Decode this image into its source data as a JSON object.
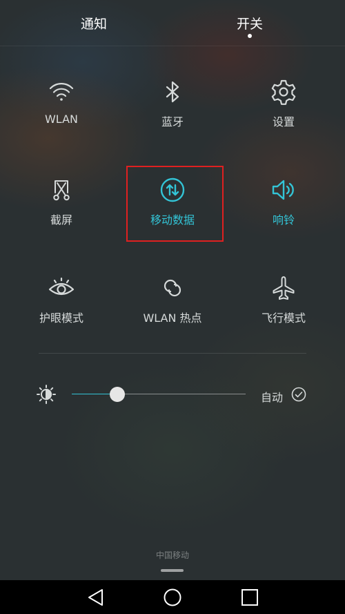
{
  "tabs": {
    "notifications": "通知",
    "switches": "开关",
    "active": "switches"
  },
  "toggles": [
    {
      "label": "WLAN",
      "icon": "wifi-icon",
      "active": false
    },
    {
      "label": "蓝牙",
      "icon": "bluetooth-icon",
      "active": false
    },
    {
      "label": "设置",
      "icon": "gear-icon",
      "active": false
    },
    {
      "label": "截屏",
      "icon": "screenshot-icon",
      "active": false
    },
    {
      "label": "移动数据",
      "icon": "mobile-data-icon",
      "active": true
    },
    {
      "label": "响铃",
      "icon": "speaker-icon",
      "active": true
    },
    {
      "label": "护眼模式",
      "icon": "eye-icon",
      "active": false
    },
    {
      "label": "WLAN 热点",
      "icon": "hotspot-icon",
      "active": false
    },
    {
      "label": "飞行模式",
      "icon": "airplane-icon",
      "active": false
    }
  ],
  "brightness": {
    "level": 0.26,
    "auto_label": "自动",
    "auto_checked": true
  },
  "carrier": "中国移动",
  "navigation": {
    "back": "back-icon",
    "home": "home-icon",
    "recent": "recent-apps-icon"
  },
  "colors": {
    "accent": "#33c4d6",
    "highlight_box": "#e02020",
    "text": "#d6dada"
  }
}
